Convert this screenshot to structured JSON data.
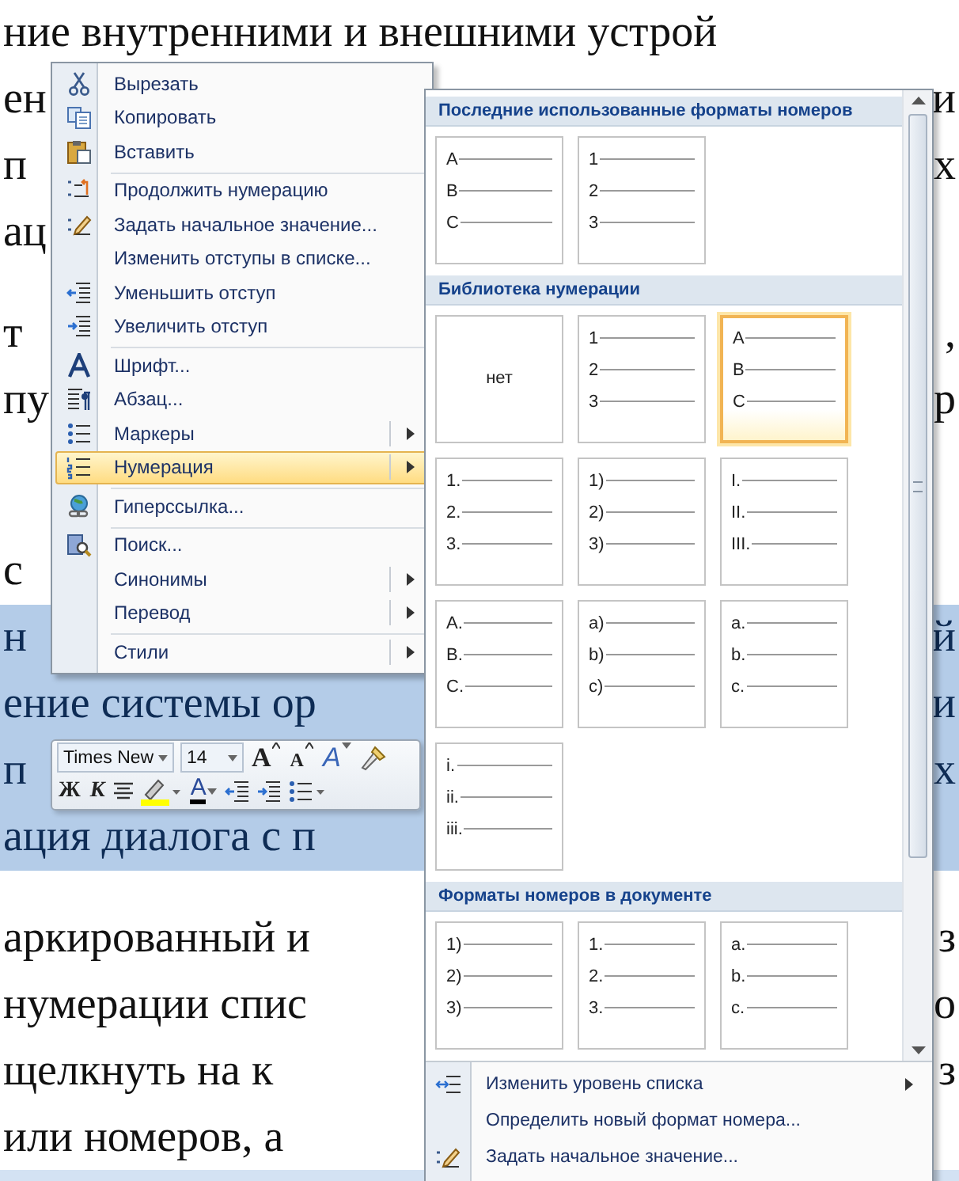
{
  "document": {
    "paragraphs": [
      {
        "lines": [
          {
            "left": "ние внутренними и внешними устрой",
            "selected": false
          },
          {
            "left": "ен",
            "right": "и",
            "selected": false
          },
          {
            "left": "п",
            "right": "х",
            "selected": false
          },
          {
            "left": "ац",
            "selected": false
          }
        ]
      },
      {
        "lines": [
          {
            "left": "т",
            "right": ",",
            "selected": false
          },
          {
            "left": "пу",
            "right": "р",
            "selected": false
          }
        ]
      },
      {
        "lines": [
          {
            "left": "с",
            "selected": false
          },
          {
            "left": "н",
            "right": "й",
            "selected": true
          },
          {
            "left": "ение системы ор",
            "right": "и",
            "selected": true
          },
          {
            "left": "п",
            "right": "х",
            "selected": true
          },
          {
            "left": "ация диалога с п",
            "selected": true
          }
        ]
      },
      {
        "lines": [
          {
            "left": "аркированный и",
            "right": "з",
            "selected": false
          },
          {
            "left": "нумерации спис",
            "right": "о",
            "selected": false
          },
          {
            "left": "щелкнуть на к",
            "right": "з",
            "selected": false
          },
          {
            "left": "или номеров, а",
            "selected": false
          }
        ]
      }
    ]
  },
  "context_menu": {
    "items": [
      {
        "kind": "scissors",
        "label": "Вырезать",
        "separator_before": false,
        "submenu": false,
        "highlighted": false
      },
      {
        "kind": "copy",
        "label": "Копировать",
        "separator_before": false,
        "submenu": false,
        "highlighted": false
      },
      {
        "kind": "paste",
        "label": "Вставить",
        "separator_before": false,
        "submenu": false,
        "highlighted": false
      },
      {
        "kind": "continue",
        "label": "Продолжить нумерацию",
        "separator_before": true,
        "submenu": false,
        "highlighted": false
      },
      {
        "kind": "setvalue",
        "label": "Задать начальное значение...",
        "separator_before": false,
        "submenu": false,
        "highlighted": false
      },
      {
        "kind": "plain",
        "label": "Изменить отступы в списке...",
        "separator_before": false,
        "submenu": false,
        "highlighted": false
      },
      {
        "kind": "outdent",
        "label": "Уменьшить отступ",
        "separator_before": false,
        "submenu": false,
        "highlighted": false
      },
      {
        "kind": "indent",
        "label": "Увеличить отступ",
        "separator_before": false,
        "submenu": false,
        "highlighted": false
      },
      {
        "kind": "font",
        "label": "Шрифт...",
        "separator_before": true,
        "submenu": false,
        "highlighted": false
      },
      {
        "kind": "paragraph",
        "label": "Абзац...",
        "separator_before": false,
        "submenu": false,
        "highlighted": false
      },
      {
        "kind": "bullets",
        "label": "Маркеры",
        "separator_before": false,
        "submenu": true,
        "highlighted": false
      },
      {
        "kind": "numbering",
        "label": "Нумерация",
        "separator_before": false,
        "submenu": true,
        "highlighted": true
      },
      {
        "kind": "hyperlink",
        "label": "Гиперссылка...",
        "separator_before": true,
        "submenu": false,
        "highlighted": false
      },
      {
        "kind": "search",
        "label": "Поиск...",
        "separator_before": true,
        "submenu": false,
        "highlighted": false
      },
      {
        "kind": "plain",
        "label": "Синонимы",
        "separator_before": false,
        "submenu": true,
        "highlighted": false
      },
      {
        "kind": "plain",
        "label": "Перевод",
        "separator_before": false,
        "submenu": true,
        "highlighted": false
      },
      {
        "kind": "plain",
        "label": "Стили",
        "separator_before": true,
        "submenu": true,
        "highlighted": false
      }
    ]
  },
  "mini_toolbar": {
    "rows": [
      {
        "items": [
          {
            "kind": "combo",
            "value": "Times New"
          },
          {
            "kind": "combo",
            "value": "14"
          },
          {
            "kind": "grow",
            "label": "A"
          },
          {
            "kind": "shrink",
            "label": "A"
          },
          {
            "kind": "styles",
            "label": "A"
          },
          {
            "kind": "painter"
          }
        ]
      },
      {
        "items": [
          {
            "kind": "bold",
            "label": "Ж"
          },
          {
            "kind": "italic",
            "label": "К"
          },
          {
            "kind": "center"
          },
          {
            "kind": "highlight"
          },
          {
            "kind": "fontcolor",
            "label": "A"
          },
          {
            "kind": "outdent"
          },
          {
            "kind": "indent"
          },
          {
            "kind": "bullets"
          }
        ]
      }
    ]
  },
  "gallery": {
    "sections": [
      {
        "title": "Последние использованные форматы номеров",
        "tiles": [
          {
            "kind": "list",
            "markers": [
              "A",
              "B",
              "C"
            ],
            "selected": false
          },
          {
            "kind": "list",
            "markers": [
              "1",
              "2",
              "3"
            ],
            "selected": false
          }
        ]
      },
      {
        "title": "Библиотека нумерации",
        "tiles": [
          {
            "kind": "none",
            "label": "нет",
            "selected": false
          },
          {
            "kind": "list",
            "markers": [
              "1",
              "2",
              "3"
            ],
            "selected": false
          },
          {
            "kind": "list",
            "markers": [
              "A",
              "B",
              "C"
            ],
            "selected": true
          },
          {
            "kind": "list",
            "markers": [
              "1.",
              "2.",
              "3."
            ],
            "selected": false
          },
          {
            "kind": "list",
            "markers": [
              "1)",
              "2)",
              "3)"
            ],
            "selected": false
          },
          {
            "kind": "list",
            "markers": [
              "I.",
              "II.",
              "III."
            ],
            "selected": false
          },
          {
            "kind": "list",
            "markers": [
              "A.",
              "B.",
              "C."
            ],
            "selected": false
          },
          {
            "kind": "list",
            "markers": [
              "a)",
              "b)",
              "c)"
            ],
            "selected": false
          },
          {
            "kind": "list",
            "markers": [
              "a.",
              "b.",
              "c."
            ],
            "selected": false
          },
          {
            "kind": "list",
            "markers": [
              "i.",
              "ii.",
              "iii."
            ],
            "selected": false
          }
        ]
      },
      {
        "title": "Форматы номеров в документе",
        "tiles": [
          {
            "kind": "list",
            "markers": [
              "1)",
              "2)",
              "3)"
            ],
            "selected": false
          },
          {
            "kind": "list",
            "markers": [
              "1.",
              "2.",
              "3."
            ],
            "selected": false
          },
          {
            "kind": "list",
            "markers": [
              "a.",
              "b.",
              "c."
            ],
            "selected": false
          }
        ]
      }
    ],
    "commands": [
      {
        "kind": "level",
        "label": "Изменить уровень списка",
        "submenu": true
      },
      {
        "kind": "plain",
        "label": "Определить новый формат номера...",
        "submenu": false
      },
      {
        "kind": "setvalue",
        "label": "Задать начальное значение...",
        "submenu": false
      }
    ]
  }
}
